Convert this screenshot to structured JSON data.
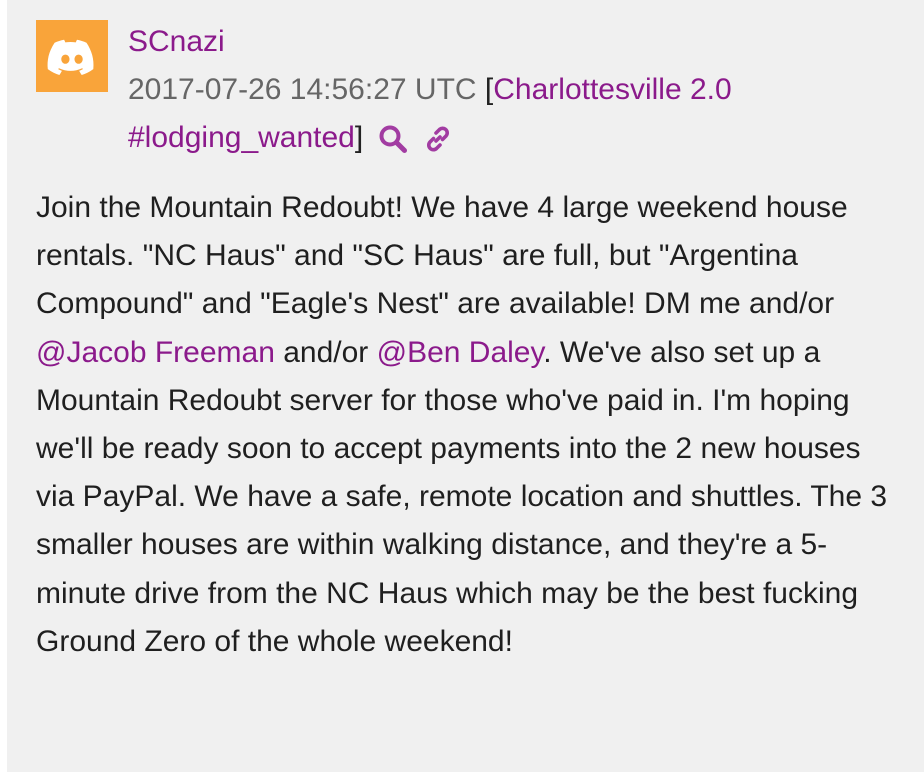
{
  "post": {
    "username": "SCnazi",
    "timestamp": "2017-07-26 14:56:27 UTC",
    "bracket_open": "[",
    "bracket_close": "]",
    "channel_link": "Charlottesville 2.0 #lodging_wanted",
    "avatar_icon": "discord-logo-icon",
    "search_icon": "search-icon",
    "permalink_icon": "link-icon",
    "accent_color": "#8b1a8b",
    "avatar_color": "#f9a43a",
    "message": {
      "part1": "Join the Mountain Redoubt! We have 4 large weekend house rentals. \"NC Haus\" and \"SC Haus\" are full, but \"Argentina Compound\" and \"Eagle's Nest\" are available! DM me and/or ",
      "mention1": "@Jacob Freeman",
      "part2": " and/or ",
      "mention2": "@Ben Daley",
      "part3": ". We've also set up a Mountain Redoubt server for those who've paid in. I'm hoping we'll be ready soon to accept payments into the 2 new houses via PayPal. We have a safe, remote location and shuttles. The 3 smaller houses are within walking distance, and they're a 5-minute drive from the NC Haus which may be the best fucking Ground Zero of the whole weekend!"
    }
  }
}
